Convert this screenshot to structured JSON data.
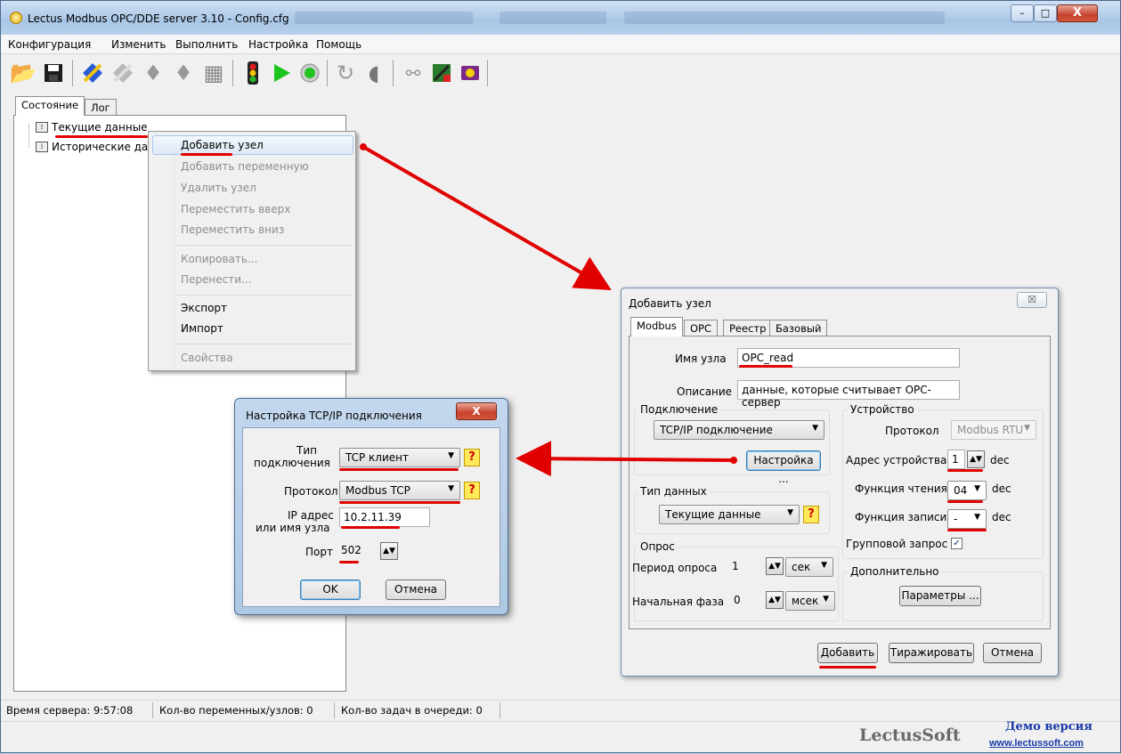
{
  "window": {
    "title": "Lectus Modbus OPC/DDE server 3.10 - Config.cfg",
    "close_glyph": "X",
    "max_glyph": "□",
    "min_glyph": "–"
  },
  "menu": [
    "Конфигурация",
    "Изменить",
    "Выполнить",
    "Настройка",
    "Помощь"
  ],
  "tabs": [
    "Состояние",
    "Лог"
  ],
  "tree": {
    "items": [
      "Текущие данные",
      "Исторические да"
    ]
  },
  "context_menu": {
    "items": [
      "Добавить узел",
      "Добавить переменную",
      "Удалить узел",
      "Переместить вверх",
      "Переместить вниз",
      "Копировать...",
      "Перенести...",
      "Экспорт",
      "Импорт",
      "Свойства"
    ]
  },
  "add_node": {
    "title": "Добавить узел",
    "close_glyph": "☒",
    "tabs": [
      "Modbus",
      "OPC",
      "Реестр",
      "Базовый"
    ],
    "name_label": "Имя узла",
    "name_value": "OPC_read",
    "desc_label": "Описание",
    "desc_value": "данные, которые считывает OPC-сервер",
    "connection_group": "Подключение",
    "connection_value": "TCP/IP подключение",
    "setup_button": "Настройка ...",
    "datatype_group": "Тип данных",
    "datatype_value": "Текущие данные",
    "poll_group": "Опрос",
    "poll_period_label": "Период опроса",
    "poll_period_value": "1",
    "poll_period_unit": "сек",
    "phase_label": "Начальная фаза",
    "phase_value": "0",
    "phase_unit": "мсек",
    "device_group": "Устройство",
    "protocol_label": "Протокол",
    "protocol_value": "Modbus RTU",
    "addr_label": "Адрес устройства",
    "addr_value": "1",
    "read_func_label": "Функция чтения",
    "read_func_value": "04",
    "write_func_label": "Функция записи",
    "write_func_value": "-",
    "dec": "dec",
    "group_req_label": "Групповой запрос",
    "extra_group": "Дополнительно",
    "params_button": "Параметры ...",
    "add_button": "Добавить",
    "replicate_button": "Тиражировать",
    "cancel_button": "Отмена"
  },
  "tcp_dialog": {
    "title": "Настройка TCP/IP подключения",
    "conn_type_label_1": "Тип",
    "conn_type_label_2": "подключения",
    "conn_type_value": "TCP клиент",
    "protocol_label": "Протокол",
    "protocol_value": "Modbus TCP",
    "ip_label_1": "IP адрес",
    "ip_label_2": "или имя узла",
    "ip_value": "10.2.11.39",
    "port_label": "Порт",
    "port_value": "502",
    "ok_button": "OK",
    "cancel_button": "Отмена",
    "help_glyph": "?"
  },
  "status": {
    "server_time": "Время сервера: 9:57:08",
    "vars_count": "Кол-во переменных/узлов: 0",
    "queue_count": "Кол-во задач в очереди: 0",
    "brand": "LectusSoft",
    "demo": "Демо версия",
    "url": "www.lectussoft.com"
  },
  "colors": {
    "accent_red": "#e00000",
    "demo_blue": "#1a3aa8",
    "brand_gray": "#6a6a6a"
  }
}
